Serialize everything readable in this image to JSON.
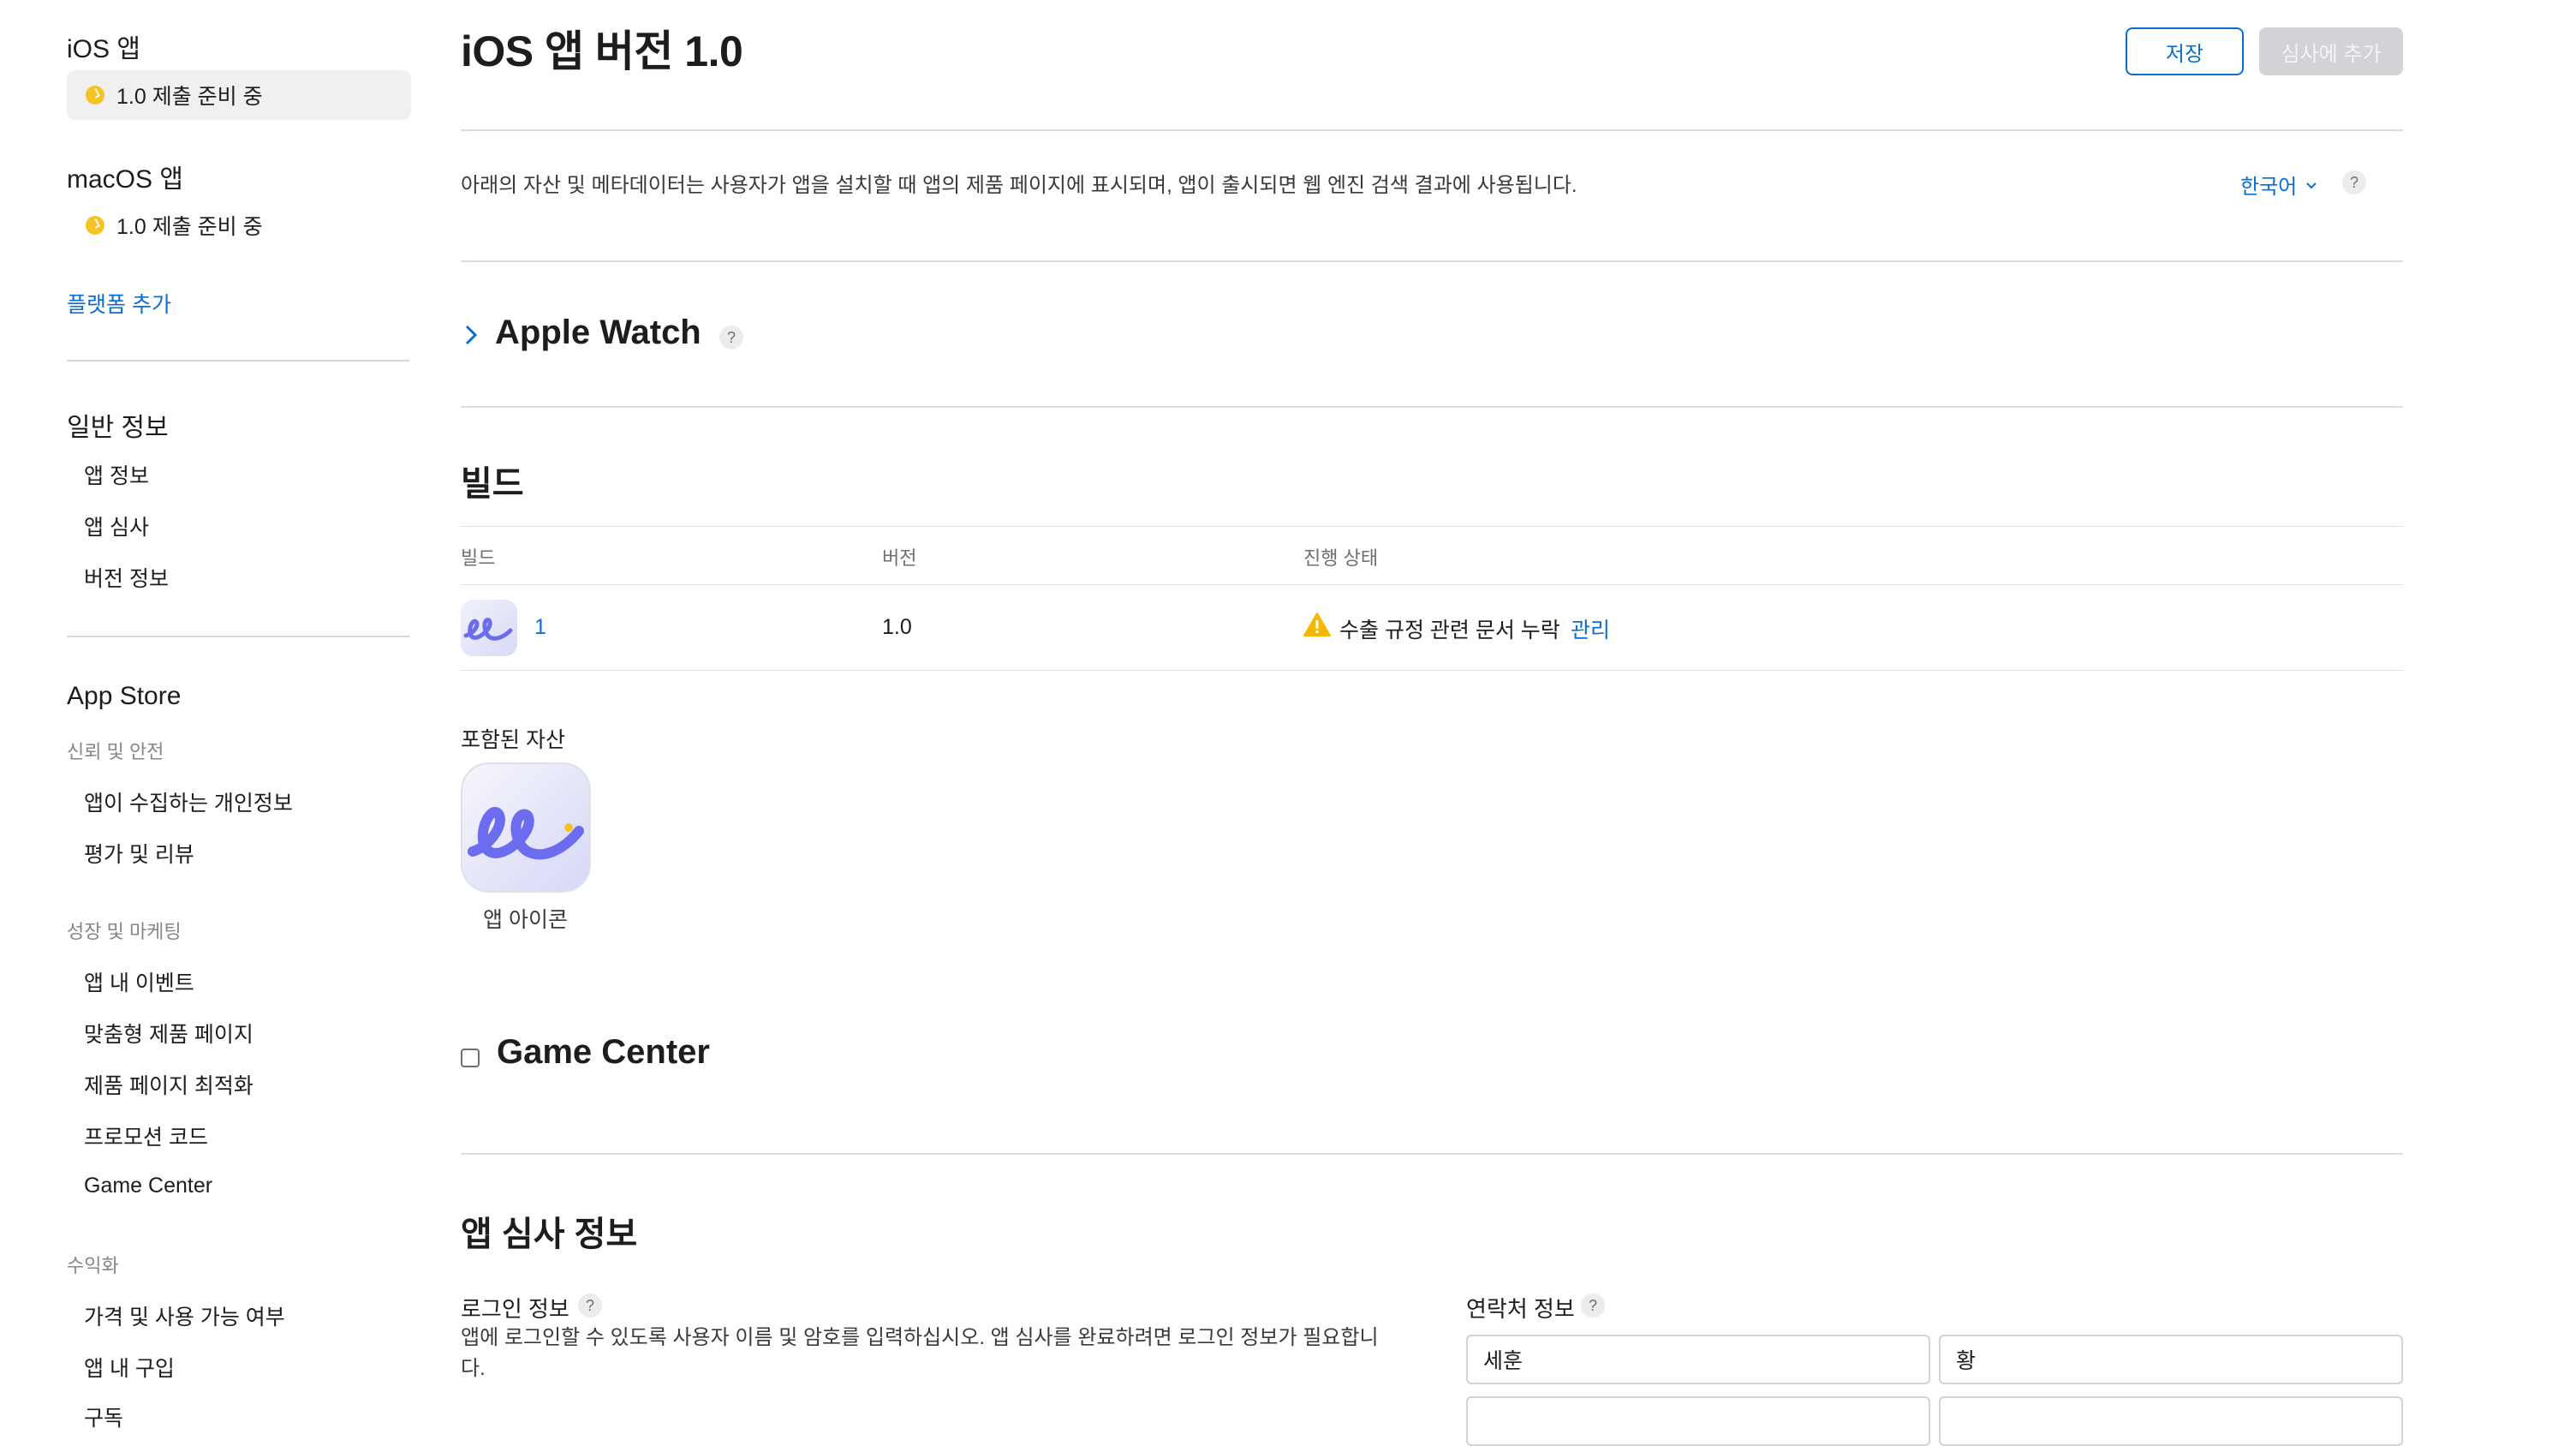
{
  "sidebar": {
    "platforms": [
      {
        "name": "iOS 앱",
        "status": "1.0 제출 준비 중",
        "active": true
      },
      {
        "name": "macOS 앱",
        "status": "1.0 제출 준비 중",
        "active": false
      }
    ],
    "add_platform": "플랫폼 추가",
    "general": {
      "heading": "일반 정보",
      "items": [
        "앱 정보",
        "앱 심사",
        "버전 정보"
      ]
    },
    "app_store": {
      "heading": "App Store",
      "groups": [
        {
          "label": "신뢰 및 안전",
          "items": [
            "앱이 수집하는 개인정보",
            "평가 및 리뷰"
          ]
        },
        {
          "label": "성장 및 마케팅",
          "items": [
            "앱 내 이벤트",
            "맞춤형 제품 페이지",
            "제품 페이지 최적화",
            "프로모션 코드",
            "Game Center"
          ]
        },
        {
          "label": "수익화",
          "items": [
            "가격 및 사용 가능 여부",
            "앱 내 구입",
            "구독"
          ]
        }
      ]
    }
  },
  "header": {
    "title": "iOS 앱 버전 1.0",
    "save_label": "저장",
    "submit_label": "심사에 추가"
  },
  "intro": {
    "text": "아래의 자산 및 메타데이터는 사용자가 앱을 설치할 때 앱의 제품 페이지에 표시되며, 앱이 출시되면 웹 엔진 검색 결과에 사용됩니다.",
    "language": "한국어",
    "help": "?"
  },
  "apple_watch": {
    "title": "Apple Watch",
    "help": "?"
  },
  "build": {
    "title": "빌드",
    "columns": [
      "빌드",
      "버전",
      "진행 상태"
    ],
    "row": {
      "build": "1",
      "version": "1.0",
      "status": "수출 규정 관련 문서 누락",
      "action": "관리"
    }
  },
  "assets": {
    "label": "포함된 자산",
    "icon_label": "앱 아이콘"
  },
  "game_center": {
    "title": "Game Center",
    "checked": false
  },
  "review": {
    "title": "앱 심사 정보",
    "login": {
      "label": "로그인 정보",
      "help": "?",
      "hint": "앱에 로그인할 수 있도록 사용자 이름 및 암호를 입력하십시오. 앱 심사를 완료하려면 로그인 정보가 필요합니다."
    },
    "contact": {
      "label": "연락처 정보",
      "help": "?",
      "first_name": "세훈",
      "last_name": "황"
    }
  },
  "colors": {
    "accent": "#0a6ed1",
    "status_yellow": "#f5c324",
    "warning": "#f5b800",
    "icon_purple": "#6b6cf0"
  }
}
